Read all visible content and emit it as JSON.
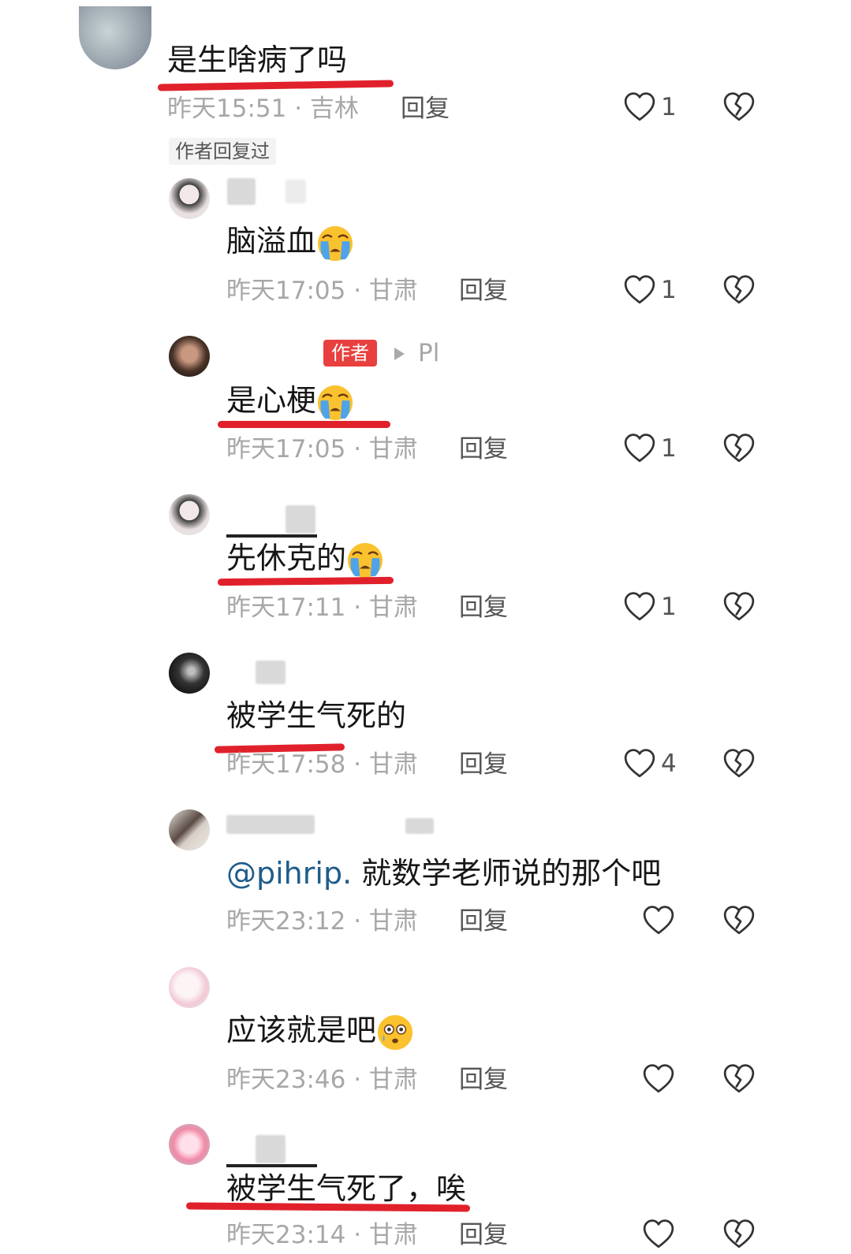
{
  "top_comment": {
    "text": "是生啥病了吗",
    "time": "昨天15:51",
    "location": "吉林",
    "reply_label": "回复",
    "like_count": "1",
    "author_replied_tag": "作者回复过"
  },
  "replies": [
    {
      "text": "脑溢血",
      "emoji": "loudly-crying-face",
      "time": "昨天17:05",
      "location": "甘肃",
      "reply_label": "回复",
      "like_count": "1"
    },
    {
      "author_badge": "作者",
      "reply_to": "Pl",
      "text": "是心梗",
      "emoji": "loudly-crying-face",
      "time": "昨天17:05",
      "location": "甘肃",
      "reply_label": "回复",
      "like_count": "1"
    },
    {
      "text": "先休克的",
      "emoji": "loudly-crying-face",
      "time": "昨天17:11",
      "location": "甘肃",
      "reply_label": "回复",
      "like_count": "1"
    },
    {
      "text": "被学生气死的",
      "time": "昨天17:58",
      "location": "甘肃",
      "reply_label": "回复",
      "like_count": "4"
    },
    {
      "mention": "@pihrip.",
      "text": " 就数学老师说的那个吧",
      "time": "昨天23:12",
      "location": "甘肃",
      "reply_label": "回复",
      "like_count": ""
    },
    {
      "text": "应该就是吧",
      "emoji": "flushed-face-with-tear",
      "time": "昨天23:46",
      "location": "甘肃",
      "reply_label": "回复",
      "like_count": ""
    },
    {
      "text": "被学生气死了，唉",
      "time": "昨天23:14",
      "location": "甘肃",
      "reply_label": "回复",
      "like_count": ""
    }
  ],
  "separator": "·",
  "colors": {
    "underline": "#e0212b",
    "author_badge": "#e8403f",
    "mention": "#1f5c8a"
  }
}
